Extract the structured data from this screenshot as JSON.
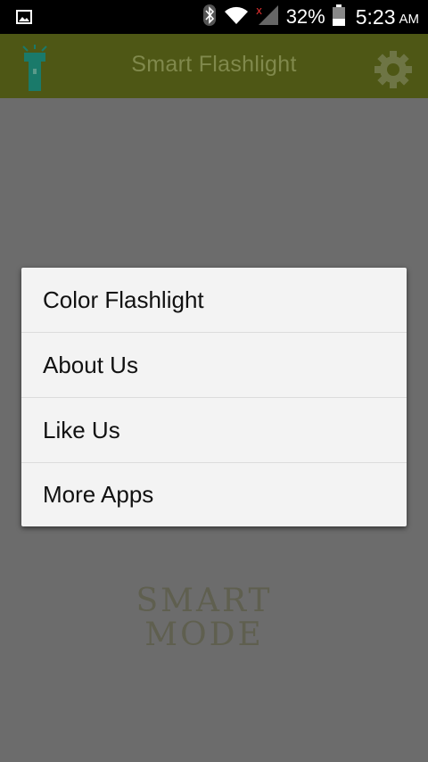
{
  "status_bar": {
    "battery": "32%",
    "time": "5:23",
    "ampm": "AM",
    "icons": [
      "image-icon",
      "bluetooth-icon",
      "wifi-icon",
      "signal-icon",
      "battery-icon"
    ]
  },
  "app_bar": {
    "title": "Smart Flashlight",
    "logo_icon": "flashlight-icon",
    "settings_icon": "gear-icon"
  },
  "menu": {
    "items": [
      {
        "label": "Color Flashlight"
      },
      {
        "label": "About Us"
      },
      {
        "label": "Like Us"
      },
      {
        "label": "More Apps"
      }
    ]
  },
  "background": {
    "mode_line1": "SMART",
    "mode_line2": "MODE"
  },
  "colors": {
    "app_bar": "#4e5715",
    "overlay": "#6c6c6c",
    "menu_bg": "#f3f3f3",
    "logo": "#1a7a6a"
  }
}
